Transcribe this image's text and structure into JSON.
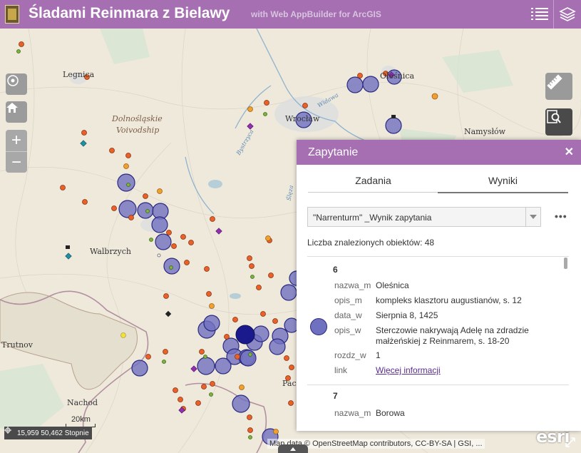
{
  "header": {
    "title": "Śladami Reinmara z Bielawy",
    "subtitle": "with Web AppBuilder for ArcGIS"
  },
  "map": {
    "cities": [
      "Legnica",
      "Oleśnica",
      "Wrocław",
      "Namysłów",
      "Walbrzych",
      "Trutnov",
      "Nachod",
      "Pacz"
    ],
    "region_label_line1": "Dolnośląskie",
    "region_label_line2": "Voivodship",
    "rivers": [
      "Widawa",
      "Bystrzyca",
      "Ślęza"
    ],
    "scale_label": "20km",
    "coordinates": "15,959 50,462 Stopnie",
    "attribution": "Map data © OpenStreetMap contributors, CC-BY-SA | GSI, ...",
    "esri_logo": "esri",
    "colors": {
      "header": "#a56fb2",
      "circle_fill": "#7070c0",
      "pin": "#e8602a"
    }
  },
  "panel": {
    "title": "Zapytanie",
    "tabs": [
      "Zadania",
      "Wyniki"
    ],
    "active_tab": "Wyniki",
    "query_name": "\"Narrenturm\" _Wynik zapytania",
    "count_label": "Liczba znalezionych obiektów: 48",
    "results": [
      {
        "id": "6",
        "fields": [
          {
            "key": "nazwa_m",
            "value": "Oleśnica"
          },
          {
            "key": "opis_m",
            "value": "kompleks klasztoru augustianów, s. 12"
          },
          {
            "key": "data_w",
            "value": "Sierpnia 8, 1425"
          },
          {
            "key": "opis_w",
            "value": "Sterczowie nakrywają Adelę na zdradzie małżeńskiej z Reinmarem, s. 18-20"
          },
          {
            "key": "rozdz_w",
            "value": "1"
          },
          {
            "key": "link",
            "value": "Więcej informacji"
          }
        ]
      },
      {
        "id": "7",
        "fields": [
          {
            "key": "nazwa_m",
            "value": "Borowa"
          }
        ]
      }
    ]
  }
}
